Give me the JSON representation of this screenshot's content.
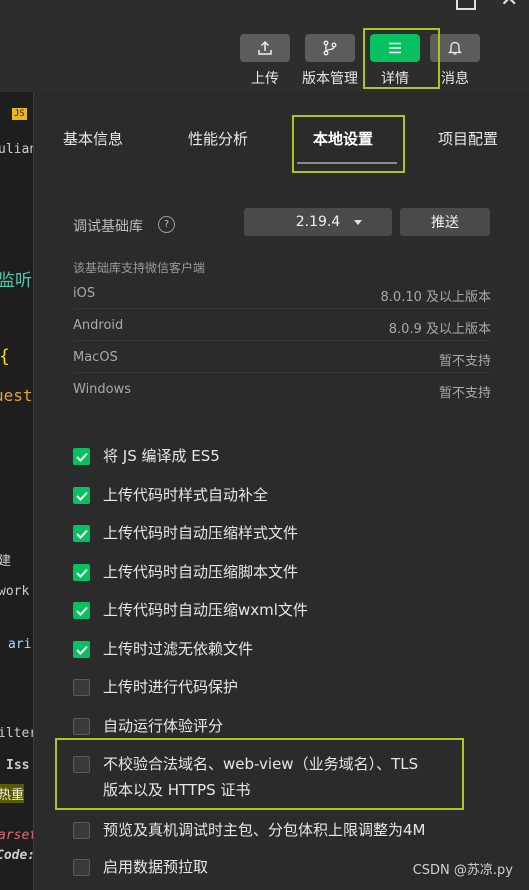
{
  "toolbar": {
    "buttons": [
      {
        "label": "上传",
        "icon": "upload-icon",
        "active": false
      },
      {
        "label": "版本管理",
        "icon": "branch-icon",
        "active": false
      },
      {
        "label": "详情",
        "icon": "menu-icon",
        "active": true
      },
      {
        "label": "消息",
        "icon": "bell-icon",
        "active": false
      }
    ],
    "accent": "#07c160",
    "highlight": "#a7c81e"
  },
  "left_fragments": [
    "JS",
    "uliano",
    "监听",
    "{",
    "uest",
    "建",
    "work",
    "ari",
    "ilter",
    "Iss",
    "热重",
    "arset",
    "Code:"
  ],
  "tabs": [
    "基本信息",
    "性能分析",
    "本地设置",
    "项目配置"
  ],
  "active_tab": "本地设置",
  "debug_lib": {
    "label": "调试基础库",
    "help_icon": "?",
    "version": "2.19.4",
    "push_label": "推送",
    "support_note": "该基础库支持微信客户端",
    "platforms": [
      {
        "name": "iOS",
        "value": "8.0.10 及以上版本"
      },
      {
        "name": "Android",
        "value": "8.0.9 及以上版本"
      },
      {
        "name": "MacOS",
        "value": "暂不支持"
      },
      {
        "name": "Windows",
        "value": "暂不支持"
      }
    ]
  },
  "options": [
    {
      "text": "将 JS 编译成 ES5",
      "checked": true
    },
    {
      "text": "上传代码时样式自动补全",
      "checked": true
    },
    {
      "text": "上传代码时自动压缩样式文件",
      "checked": true
    },
    {
      "text": "上传代码时自动压缩脚本文件",
      "checked": true
    },
    {
      "text": "上传代码时自动压缩wxml文件",
      "checked": true
    },
    {
      "text": "上传时过滤无依赖文件",
      "checked": true
    },
    {
      "text": "上传时进行代码保护",
      "checked": false
    },
    {
      "text": "自动运行体验评分",
      "checked": false
    },
    {
      "text": "不校验合法域名、web-view（业务域名）、TLS",
      "text2": "版本以及 HTTPS 证书",
      "checked": false
    },
    {
      "text": "预览及真机调试时主包、分包体积上限调整为4M",
      "checked": false
    },
    {
      "text": "启用数据预拉取",
      "checked": false
    }
  ],
  "watermark": "CSDN @苏凉.py"
}
